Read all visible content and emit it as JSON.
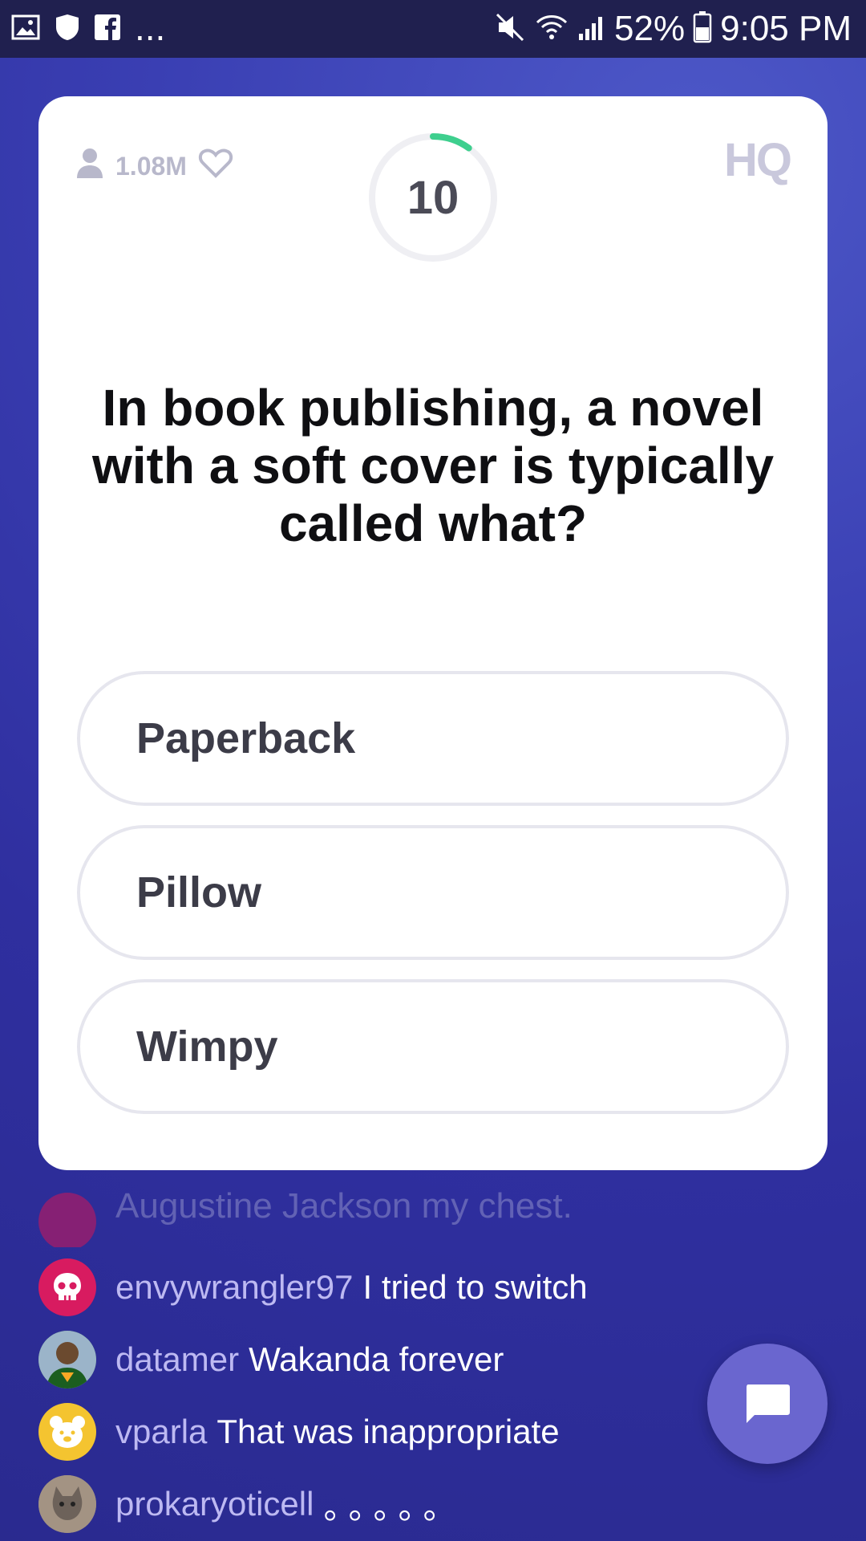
{
  "status_bar": {
    "ellipsis": "...",
    "battery_percent": "52%",
    "time": "9:05 PM"
  },
  "game": {
    "viewers": "1.08M",
    "timer": "10",
    "timer_remaining_fraction": 0.1,
    "brand": "HQ",
    "question": "In book publishing, a novel with a soft cover is typically called what?",
    "answers": [
      "Paperback",
      "Pillow",
      "Wimpy"
    ]
  },
  "chat": {
    "faded_message": "Augustine Jackson my chest.",
    "messages": [
      {
        "user": "envywrangler97",
        "text": "I tried to switch",
        "avatar_color": "#d81b60"
      },
      {
        "user": "datamer",
        "text": "Wakanda forever",
        "avatar_color": "#2e7d32"
      },
      {
        "user": "vparla",
        "text": "That was inappropriate",
        "avatar_color": "#f4c430"
      },
      {
        "user": "prokaryoticell",
        "text": "。。。。。",
        "avatar_color": "#8d7f73"
      }
    ]
  },
  "colors": {
    "background": "#2f2f9f",
    "timer_progress": "#3ecf8e",
    "username": "#bdb9f2",
    "chat_button": "#6a66cf"
  }
}
